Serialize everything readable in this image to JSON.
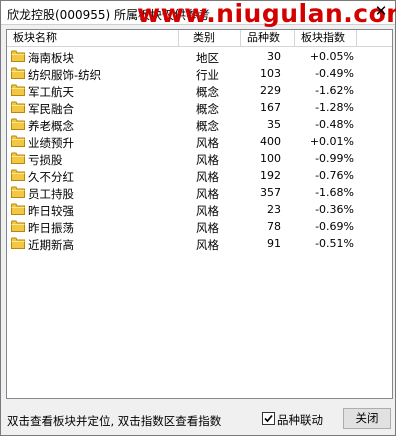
{
  "window": {
    "title": "欣龙控股(000955)  所属板块仅供参考",
    "watermark": "www.niugulan.com"
  },
  "columns": {
    "name": "板块名称",
    "type": "类别",
    "count": "品种数",
    "index": "板块指数"
  },
  "rows": [
    {
      "name": "海南板块",
      "type": "地区",
      "count": "30",
      "index": "+0.05%"
    },
    {
      "name": "纺织服饰-纺织",
      "type": "行业",
      "count": "103",
      "index": "-0.49%"
    },
    {
      "name": "军工航天",
      "type": "概念",
      "count": "229",
      "index": "-1.62%"
    },
    {
      "name": "军民融合",
      "type": "概念",
      "count": "167",
      "index": "-1.28%"
    },
    {
      "name": "养老概念",
      "type": "概念",
      "count": "35",
      "index": "-0.48%"
    },
    {
      "name": "业绩预升",
      "type": "风格",
      "count": "400",
      "index": "+0.01%"
    },
    {
      "name": "亏损股",
      "type": "风格",
      "count": "100",
      "index": "-0.99%"
    },
    {
      "name": "久不分红",
      "type": "风格",
      "count": "192",
      "index": "-0.76%"
    },
    {
      "name": "员工持股",
      "type": "风格",
      "count": "357",
      "index": "-1.68%"
    },
    {
      "name": "昨日较强",
      "type": "风格",
      "count": "23",
      "index": "-0.36%"
    },
    {
      "name": "昨日振荡",
      "type": "风格",
      "count": "78",
      "index": "-0.69%"
    },
    {
      "name": "近期新高",
      "type": "风格",
      "count": "91",
      "index": "-0.51%"
    }
  ],
  "status": {
    "hint": "双击查看板块并定位, 双击指数区查看指数",
    "link_label": "品种联动",
    "link_checked": true,
    "close_label": "关闭"
  },
  "icons": {
    "folder": "folder-icon",
    "close": "close-icon",
    "check": "check-icon"
  },
  "colors": {
    "folder": "#f2c744",
    "watermark": "#d40000"
  }
}
